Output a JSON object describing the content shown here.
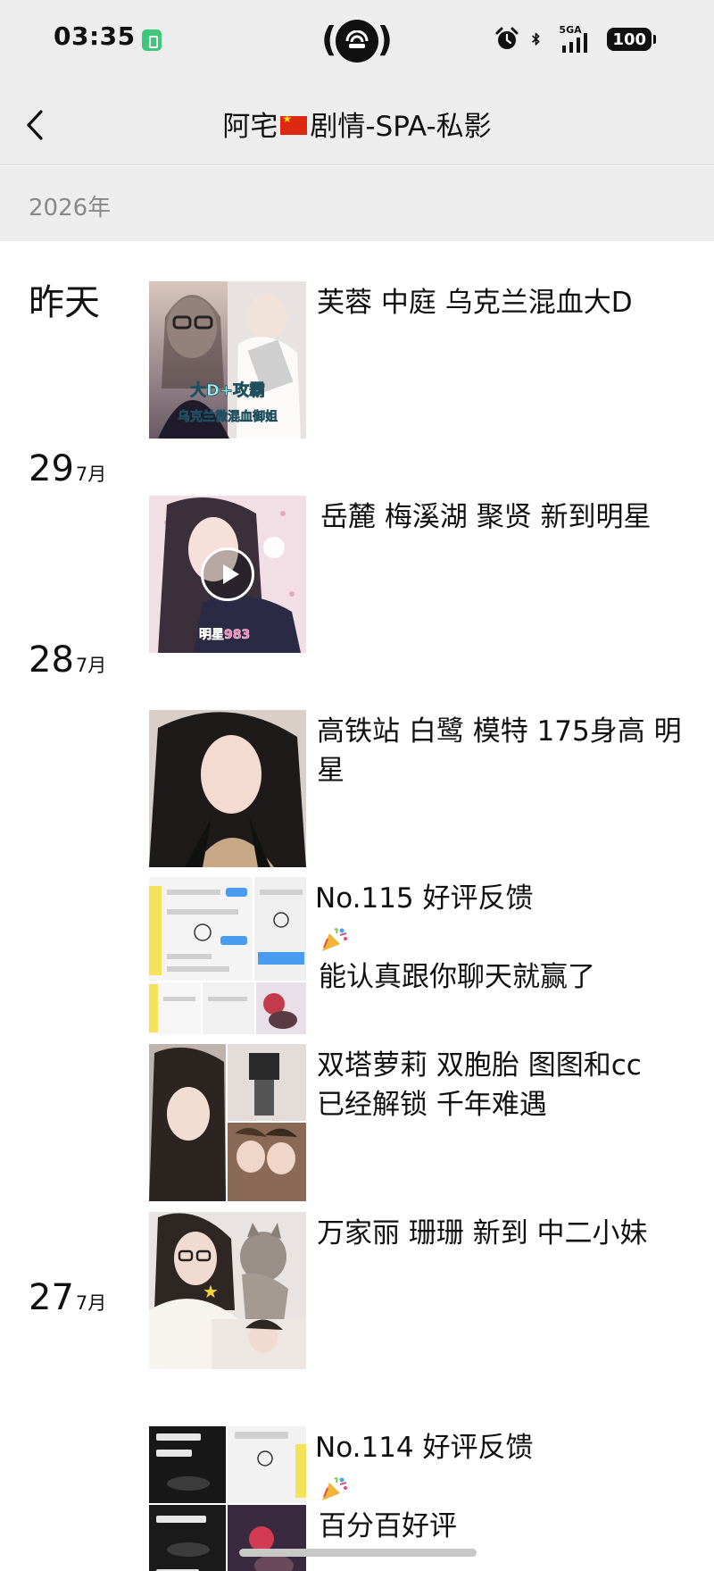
{
  "status_bar": {
    "time": "03:35",
    "battery": "100",
    "network": "5GA"
  },
  "nav": {
    "title_prefix": "阿宅",
    "title_suffix": "剧情-SPA-私影"
  },
  "year_label": "2026年",
  "days": [
    {
      "label": "昨天",
      "posts": [
        {
          "caption": [
            "芙蓉 中庭 乌克兰混血大D"
          ],
          "thumb_text": "大D+攻霸 乌克兰微混血御姐"
        }
      ]
    },
    {
      "day": "29",
      "month": "7月",
      "posts": [
        {
          "caption": [
            "岳麓 梅溪湖 聚贤 新到明星"
          ],
          "thumb_text": "明星983",
          "video": true
        }
      ]
    },
    {
      "day": "28",
      "month": "7月",
      "posts": [
        {
          "caption": [
            "高铁站 白鹭 模特 175身高 明",
            "星"
          ]
        },
        {
          "caption": [
            "No.115 好评反馈",
            "能认真跟你聊天就赢了"
          ],
          "party_emoji": true
        },
        {
          "caption": [
            "双塔萝莉 双胞胎 图图和cc",
            "已经解锁 千年难遇"
          ]
        },
        {
          "caption": [
            "万家丽 珊珊 新到 中二小妹"
          ]
        }
      ]
    },
    {
      "day": "27",
      "month": "7月",
      "posts": [
        {
          "caption": [
            "No.114 好评反馈",
            "百分百好评"
          ],
          "party_emoji": true
        }
      ]
    }
  ]
}
